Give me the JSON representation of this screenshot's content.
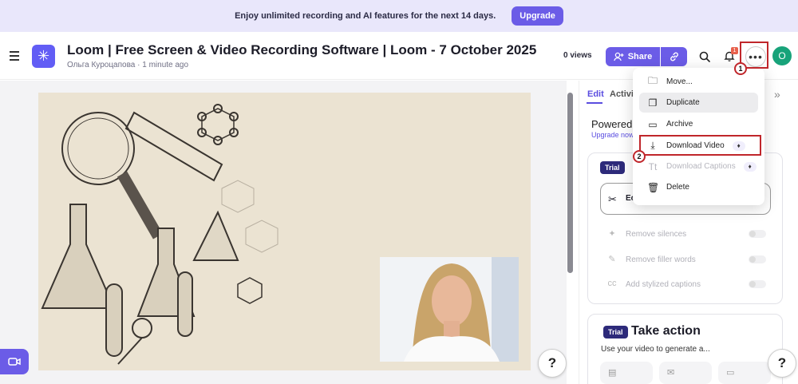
{
  "banner": {
    "text": "Enjoy unlimited recording and AI features for the next 14 days.",
    "upgrade_label": "Upgrade"
  },
  "header": {
    "title": "Loom | Free Screen & Video Recording Software | Loom - 7 October 2025",
    "author": "Ольга Куроцапова",
    "time": "1 minute ago",
    "views": "0 views",
    "share_label": "Share",
    "notification_count": "1",
    "avatar_letter": "O",
    "brand_color": "#625df5"
  },
  "annotations": {
    "step1": "1",
    "step2": "2"
  },
  "menu": {
    "items": [
      {
        "label": "Move...",
        "icon": "folder-icon"
      },
      {
        "label": "Duplicate",
        "icon": "duplicate-icon"
      },
      {
        "label": "Archive",
        "icon": "archive-icon"
      },
      {
        "label": "Download Video",
        "icon": "download-icon"
      },
      {
        "label": "Download Captions",
        "icon": "captions-icon"
      },
      {
        "label": "Delete",
        "icon": "trash-icon"
      }
    ]
  },
  "side_panel": {
    "tab_edit": "Edit",
    "tab_activity": "Activit",
    "powered": "Powered",
    "upgrade_now": "Upgrade now",
    "trial_badge": "Trial",
    "edit_card_label": "Ec",
    "features": [
      "Remove silences",
      "Remove filler words",
      "Add stylized captions"
    ],
    "take_action_title": "Take action",
    "take_action_sub": "Use your video to generate a..."
  },
  "help_label": "?"
}
